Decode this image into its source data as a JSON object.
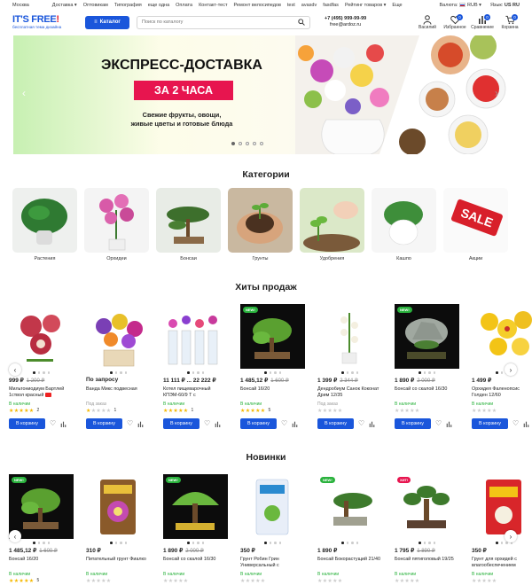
{
  "topbar": {
    "city": "Москва",
    "nav": [
      "Доставка ▾",
      "Оптовикам",
      "Типография",
      "еще одна",
      "Оплата",
      "Контакт-тест",
      "Ремонт велосипедов",
      "test",
      "avasdv",
      "fasdfas",
      "Рейтинг товаров ▾",
      "Еще"
    ],
    "currency_label": "Валюта:",
    "currency_value": "RUB ▾",
    "language_label": "Язык:",
    "language_value": "US RU"
  },
  "header": {
    "logo_main": "IT'S FREE",
    "logo_excl": "!",
    "logo_sub": "бесплатная тема дизайна",
    "catalog_label": "Каталог",
    "search_placeholder": "Поиск по каталогу",
    "phone": "+7 (495) 999-99-99",
    "email": "free@ardoz.ru",
    "icons": [
      {
        "label": "Василий",
        "icon": "user-icon",
        "badge": ""
      },
      {
        "label": "Избранное",
        "icon": "heart-icon",
        "badge": "0"
      },
      {
        "label": "Сравнение",
        "icon": "compare-icon",
        "badge": "0"
      },
      {
        "label": "Корзина",
        "icon": "cart-icon",
        "badge": "0"
      }
    ]
  },
  "banner": {
    "title": "ЭКСПРЕСС-ДОСТАВКА",
    "highlight": "ЗА 2 ЧАСА",
    "subtitle_1": "Свежие фрукты, овощи,",
    "subtitle_2": "живые цветы и готовые блюда",
    "slides": 5,
    "active_slide": 0
  },
  "categories": {
    "title": "Категории",
    "items": [
      "Растения",
      "Орхидеи",
      "Бонсаи",
      "Грунты",
      "Удобрения",
      "Кашпо",
      "Акции"
    ],
    "sale_text": "SALE"
  },
  "hits": {
    "title": "Хиты продаж",
    "products": [
      {
        "price": "999 ₽",
        "old": "1 200 ₽",
        "name": "Мильтониодиум Бартлей 1ствол красный",
        "stock": "В наличии",
        "order": false,
        "rating": 5,
        "reviews": "2",
        "badge": "",
        "yt": true
      },
      {
        "price": "По запросу",
        "old": "",
        "name": "Ванда Микс подвесная",
        "stock": "Под заказ",
        "order": true,
        "rating": 1,
        "reviews": "1",
        "badge": "",
        "yt": false
      },
      {
        "price": "11 111 ₽ ... 22 222 ₽",
        "old": "",
        "name": "Котел пищеварочный КПЭМ-60/9 Т с",
        "stock": "В наличии",
        "order": false,
        "rating": 5,
        "reviews": "1",
        "badge": "",
        "yt": false
      },
      {
        "price": "1 485,12 ₽",
        "old": "1 600 ₽",
        "name": "Бонсай 16/20",
        "stock": "В наличии",
        "order": false,
        "rating": 5,
        "reviews": "5",
        "badge": "NEW!",
        "yt": false
      },
      {
        "price": "1 399 ₽",
        "old": "2 344 ₽",
        "name": "Дендробиум Санок Коконат Дрим 12/35",
        "stock": "Под заказ",
        "order": true,
        "rating": 0,
        "reviews": "",
        "badge": "",
        "yt": false
      },
      {
        "price": "1 890 ₽",
        "old": "2 000 ₽",
        "name": "Бонсай со скалой 16/30",
        "stock": "В наличии",
        "order": false,
        "rating": 0,
        "reviews": "",
        "badge": "NEW!",
        "yt": false
      },
      {
        "price": "1 499 ₽",
        "old": "",
        "name": "Орхидея Фаленопсис Голден 12/60",
        "stock": "В наличии",
        "order": false,
        "rating": 0,
        "reviews": "",
        "badge": "",
        "yt": false
      }
    ],
    "buy_label": "В корзину"
  },
  "news": {
    "title": "Новинки",
    "products": [
      {
        "price": "1 485,12 ₽",
        "old": "1 600 ₽",
        "name": "Бонсай 16/20",
        "stock": "В наличии",
        "order": false,
        "rating": 5,
        "reviews": "5",
        "badge": "NEW!"
      },
      {
        "price": "310 ₽",
        "old": "",
        "name": "Питательный грунт Фиалко",
        "stock": "В наличии",
        "order": false,
        "rating": 0,
        "reviews": "",
        "badge": ""
      },
      {
        "price": "1 890 ₽",
        "old": "2 000 ₽",
        "name": "Бонсай со скалой 16/30",
        "stock": "В наличии",
        "order": false,
        "rating": 0,
        "reviews": "",
        "badge": "NEW!"
      },
      {
        "price": "350 ₽",
        "old": "",
        "name": "Грунт Робин Грин Универсальный с",
        "stock": "В наличии",
        "order": false,
        "rating": 0,
        "reviews": "",
        "badge": ""
      },
      {
        "price": "1 890 ₽",
        "old": "",
        "name": "Бонсай Бокорастущий 21/40",
        "stock": "В наличии",
        "order": false,
        "rating": 0,
        "reviews": "",
        "badge": "NEW!"
      },
      {
        "price": "1 795 ₽",
        "old": "1 890 ₽",
        "name": "Бонсай пятиголовый 19/25",
        "stock": "В наличии",
        "order": false,
        "rating": 0,
        "reviews": "",
        "badge": "ХИТ!"
      },
      {
        "price": "350 ₽",
        "old": "",
        "name": "Грунт для орхидей с влагообеспечением",
        "stock": "В наличии",
        "order": false,
        "rating": 0,
        "reviews": "",
        "badge": ""
      }
    ]
  },
  "colors": {
    "accent": "#1a56db",
    "logo_red": "#e6202f",
    "banner_pink": "#e7154f",
    "stock_green": "#2ab23d",
    "star": "#f5b800"
  }
}
